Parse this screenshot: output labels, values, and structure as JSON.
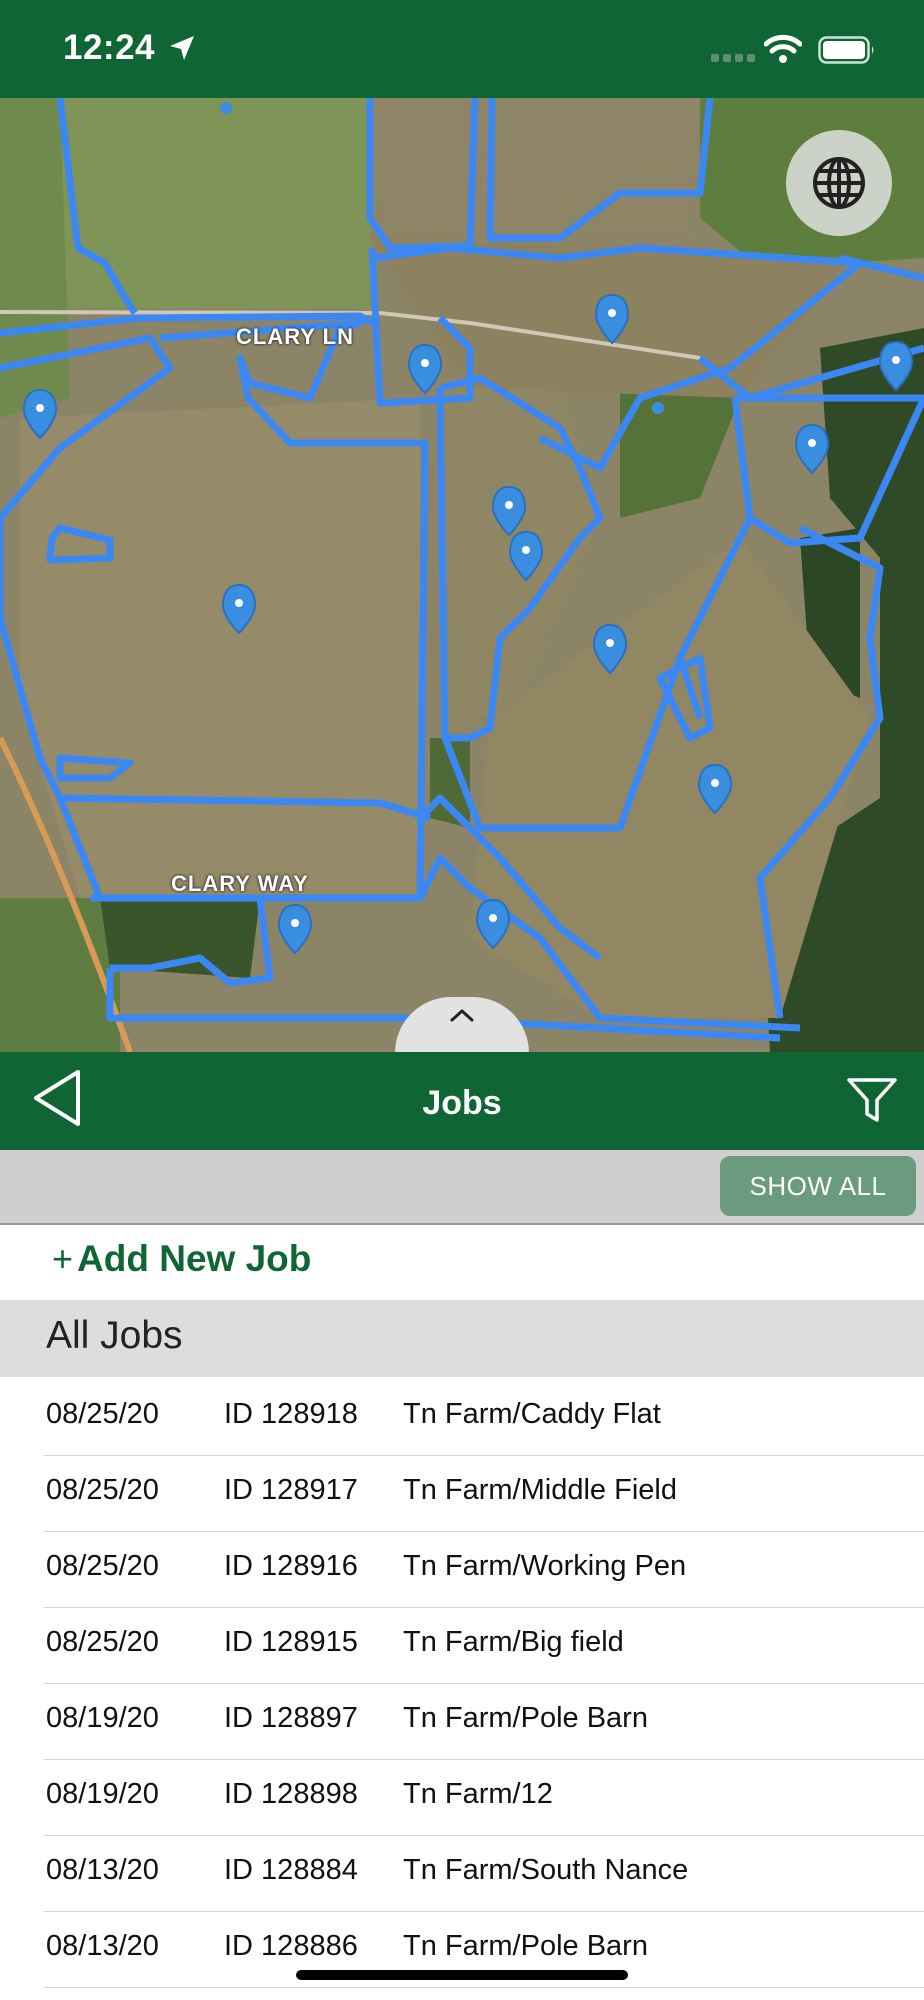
{
  "status_bar": {
    "time": "12:24",
    "icons": [
      "location-arrow-icon",
      "cellular-signal-icon",
      "wifi-icon",
      "battery-icon"
    ]
  },
  "map": {
    "labels": [
      "CLARY LN",
      "CLARY WAY"
    ],
    "boundary_color": "#3b88f5",
    "pin_color": "#3a8ee0"
  },
  "nav": {
    "title": "Jobs",
    "back_icon": "back-triangle-icon",
    "filter_icon": "filter-funnel-icon"
  },
  "toolbar": {
    "show_all_label": "SHOW ALL"
  },
  "add_job": {
    "plus": "+",
    "label": "Add New Job"
  },
  "section": {
    "title": "All Jobs"
  },
  "jobs": [
    {
      "date": "08/25/20",
      "id": "ID 128918",
      "name": "Tn Farm/Caddy Flat"
    },
    {
      "date": "08/25/20",
      "id": "ID 128917",
      "name": "Tn Farm/Middle Field"
    },
    {
      "date": "08/25/20",
      "id": "ID 128916",
      "name": "Tn Farm/Working Pen"
    },
    {
      "date": "08/25/20",
      "id": "ID 128915",
      "name": "Tn Farm/Big field"
    },
    {
      "date": "08/19/20",
      "id": "ID 128897",
      "name": "Tn Farm/Pole Barn"
    },
    {
      "date": "08/19/20",
      "id": "ID 128898",
      "name": "Tn Farm/12"
    },
    {
      "date": "08/13/20",
      "id": "ID 128884",
      "name": "Tn Farm/South Nance"
    },
    {
      "date": "08/13/20",
      "id": "ID 128886",
      "name": "Tn Farm/Pole Barn"
    }
  ],
  "colors": {
    "brand_green": "#0f6634",
    "show_all_bg": "#6a9b7e"
  }
}
